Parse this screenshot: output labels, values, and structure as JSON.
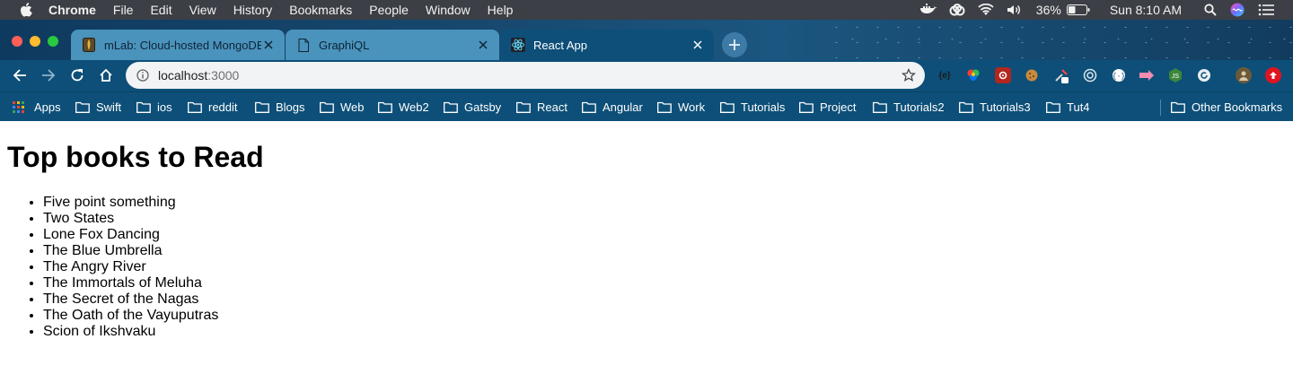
{
  "menubar": {
    "items": [
      "Chrome",
      "File",
      "Edit",
      "View",
      "History",
      "Bookmarks",
      "People",
      "Window",
      "Help"
    ],
    "battery": "36%",
    "clock": "Sun 8:10 AM"
  },
  "tabs": [
    {
      "title": "mLab: Cloud-hosted MongoDB",
      "icon": "mlab-icon"
    },
    {
      "title": "GraphiQL",
      "icon": "page-icon"
    },
    {
      "title": "React App",
      "icon": "react-icon"
    }
  ],
  "address_bar": {
    "host": "localhost",
    "port": ":3000"
  },
  "bookmarks": {
    "apps_label": "Apps",
    "folders": [
      "Swift",
      "ios",
      "reddit",
      "Blogs",
      "Web",
      "Web2",
      "Gatsby",
      "React",
      "Angular",
      "Work",
      "Tutorials",
      "Project",
      "Tutorials2",
      "Tutorials3",
      "Tut4"
    ],
    "other": "Other Bookmarks"
  },
  "page": {
    "title": "Top books to Read",
    "books": [
      "Five point something",
      "Two States",
      "Lone Fox Dancing",
      "The Blue Umbrella",
      "The Angry River",
      "The Immortals of Meluha",
      "The Secret of the Nagas",
      "The Oath of the Vayuputras",
      "Scion of Ikshvaku"
    ]
  },
  "colors": {
    "menubar": "#3c3f45",
    "toolbar": "#0d4f78",
    "inactive_tab": "#4a93bc",
    "omnibox": "#f1f3f4"
  }
}
